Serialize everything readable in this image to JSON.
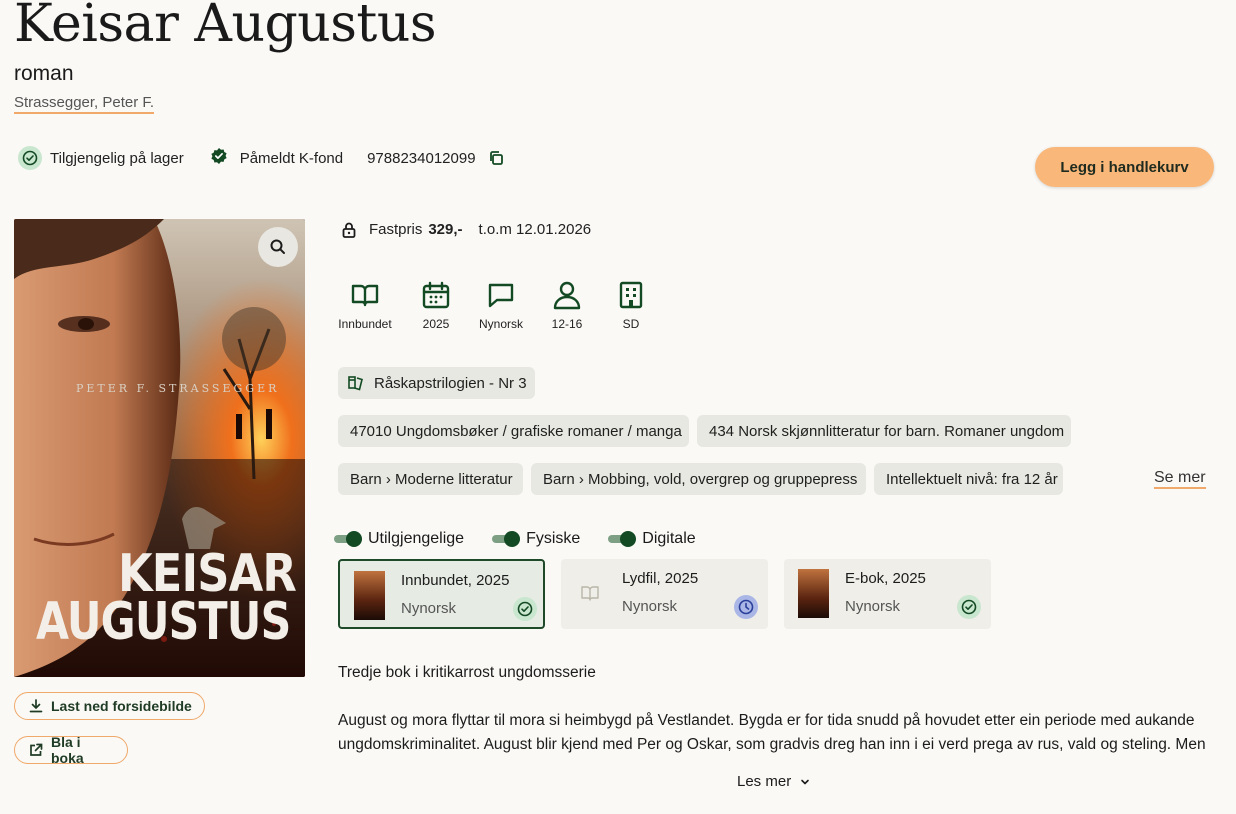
{
  "book": {
    "title": "Keisar Augustus",
    "subtitle": "roman",
    "author": "Strassegger, Peter F."
  },
  "status": {
    "availability": "Tilgjengelig på lager",
    "kfond": "Påmeldt K-fond",
    "isbn": "9788234012099"
  },
  "actions": {
    "add_to_cart": "Legg i handlekurv",
    "download_cover": "Last ned forsidebilde",
    "browse": "Bla i boka"
  },
  "cover": {
    "author_text": "PETER F. STRASSEGGER",
    "title_line1": "KEISAR",
    "title_line2": "AUGUSTUS"
  },
  "price": {
    "label": "Fastpris",
    "value": "329,-",
    "valid_until": "t.o.m 12.01.2026"
  },
  "attributes": [
    {
      "icon": "book-open-icon",
      "label": "Innbundet"
    },
    {
      "icon": "calendar-icon",
      "label": "2025"
    },
    {
      "icon": "speech-bubble-icon",
      "label": "Nynorsk"
    },
    {
      "icon": "person-icon",
      "label": "12-16"
    },
    {
      "icon": "building-icon",
      "label": "SD"
    }
  ],
  "series": "Råskapstrilogien - Nr 3",
  "categories": [
    "47010 Ungdomsbøker / grafiske romaner / manga",
    "434 Norsk skjønnlitteratur for barn. Romaner ungdom",
    "Barn › Moderne litteratur",
    "Barn › Mobbing, vold, overgrep og gruppepress",
    "Intellektuelt nivå: fra 12 år"
  ],
  "see_more": "Se mer",
  "filters": [
    {
      "label": "Utilgjengelige",
      "on": true
    },
    {
      "label": "Fysiske",
      "on": true
    },
    {
      "label": "Digitale",
      "on": true
    }
  ],
  "editions": [
    {
      "format": "Innbundet, 2025",
      "language": "Nynorsk",
      "status": "available",
      "selected": true
    },
    {
      "format": "Lydfil, 2025",
      "language": "Nynorsk",
      "status": "pending",
      "selected": false
    },
    {
      "format": "E-bok, 2025",
      "language": "Nynorsk",
      "status": "available",
      "selected": false
    }
  ],
  "description": {
    "lead": "Tredje bok i kritikarrost ungdomsserie",
    "line1": "August og mora flyttar til mora si heimbygd på Vestlandet. Bygda er for tida snudd på hovudet etter ein periode med aukande",
    "line2": "ungdomskriminalitet. August blir kjend med Per og Oskar, som gradvis dreg han inn i ei verd prega av rus, vald og steling. Men",
    "read_more": "Les mer"
  },
  "colors": {
    "accent": "#f9b77a",
    "dark_green": "#134a23",
    "background": "#faf9f6",
    "chip": "#e7e8e1"
  }
}
